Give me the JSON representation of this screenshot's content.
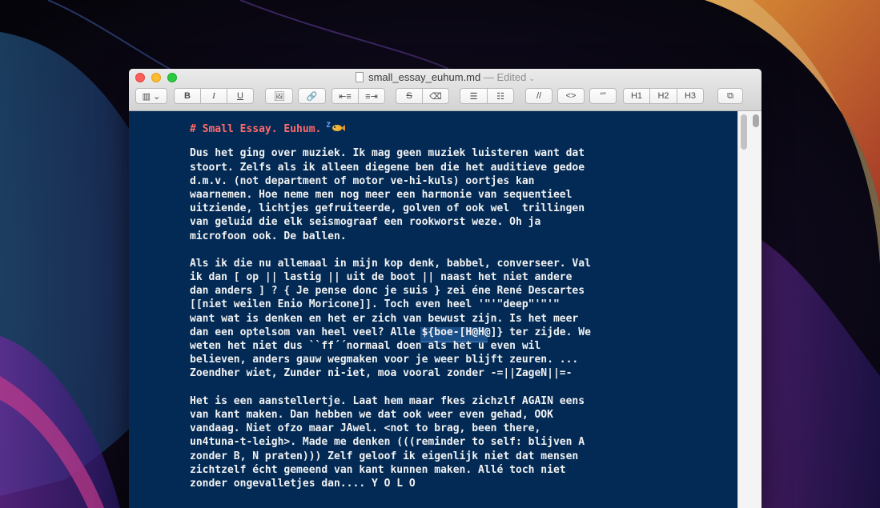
{
  "window": {
    "filename": "small_essay_euhum.md",
    "separator": "—",
    "status": "Edited",
    "status_chevron": "⌄"
  },
  "toolbar": {
    "sidebar_toggle": "▥ ⌄",
    "bold": "B",
    "italic": "I",
    "underline": "U",
    "image": "🖼",
    "link": "🔗",
    "outdent": "⇤≡",
    "indent": "≡⇥",
    "strikethrough": "S",
    "clear_format": "⌫",
    "bullet_list": "☰",
    "numbered_list": "☷",
    "comment": "//",
    "code": "<>",
    "quote": "“”",
    "h1": "H1",
    "h2": "H2",
    "h3": "H3",
    "copy": "⧉"
  },
  "editor": {
    "heading_icon_text": "Z",
    "lines": [
      "# Small Essay. Euhum.",
      "",
      "Dus het ging over muziek. Ik mag geen muziek luisteren want dat",
      "stoort. Zelfs als ik alleen diegene ben die het auditieve gedoe",
      "d.m.v. (not department of motor ve-hi-kuls) oortjes kan",
      "waarnemen. Hoe neme men nog meer een harmonie van sequentieel",
      "uitziende, lichtjes gefruiteerde, golven of ook wel  trillingen",
      "van geluid die elk seismograaf een rookworst weze. Oh ja",
      "microfoon ook. De ballen.",
      "",
      "Als ik die nu allemaal in mijn kop denk, babbel, converseer. Val",
      "ik dan [ op || lastig || uit de boot || naast het niet andere",
      "dan anders ] ? { Je pense donc je suis } zei éne René Descartes",
      "[[niet weilen Enio Moricone]]. Toch even heel '\"'\"deep\"'\"'\"",
      "want wat is denken en het er zich van bewust zijn. Is het meer",
      "dan een optelsom van heel veel? Alle ${boe-[H@H@]} ter zijde. We",
      "weten het niet dus ``ff´´normaal doen als het u even wil",
      "believen, anders gauw wegmaken voor je weer blijft zeuren. ...",
      "Zoendher wiet, Zunder ni-iet, moa vooral zonder -=||ZageN||=-",
      "",
      "Het is een aanstellertje. Laat hem maar fkes zichzlf AGAIN eens",
      "van kant maken. Dan hebben we dat ook weer even gehad, OOK",
      "vandaag. Niet ofzo maar JAwel. <not to brag, been there,",
      "un4tuna-t-leigh>. Made me denken (((reminder to self: blijven A",
      "zonder B, N praten))) Zelf geloof ik eigenlijk niet dat mensen",
      "zichtzelf écht gemeend van kant kunnen maken. Allé toch niet",
      "zonder ongevalletjes dan.... Y O L O"
    ]
  },
  "colors": {
    "editor_background": "#022a55",
    "editor_text": "#f2f2f2",
    "heading": "#ff6a6a",
    "selection": "#1b4f8a"
  },
  "icons": {
    "window_close": "close-icon",
    "window_minimize": "minimize-icon",
    "window_zoom": "zoom-icon",
    "document": "document-icon",
    "heading_decoration": "sleeping-fish-icon"
  }
}
